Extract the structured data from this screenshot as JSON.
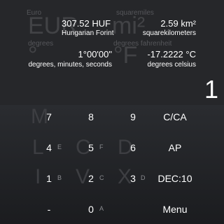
{
  "converter": {
    "row1": {
      "left_ghost_label": "Euro",
      "left_ghost_big": "EUR",
      "left_value": "307.52 HUF",
      "left_unit": "Hungarian Forint",
      "right_ghost_label": "squaremiles",
      "right_ghost_big": "mi²",
      "right_value": "2.59 km²",
      "right_unit": "squarekilometers"
    },
    "row2": {
      "left_ghost_label": "degrees",
      "left_ghost_big": "°",
      "left_value": "1°00'00\"",
      "left_unit": "degrees, minutes, seconds",
      "right_ghost_label": "degrees fahrenheit",
      "right_ghost_big": "°F",
      "right_value": "-17.2222 °C",
      "right_unit": "degrees celsius"
    }
  },
  "display": {
    "result": "1"
  },
  "keypad": {
    "ghost_letters": [
      "M",
      "L",
      "C",
      "D",
      "I",
      "V",
      "X"
    ],
    "rows": [
      {
        "keys": [
          {
            "label": "7",
            "hint": ""
          },
          {
            "label": "8",
            "hint": ""
          },
          {
            "label": "9",
            "hint": ""
          }
        ],
        "action": "C/CA"
      },
      {
        "keys": [
          {
            "label": "4",
            "hint": "E"
          },
          {
            "label": "5",
            "hint": "F"
          },
          {
            "label": "6",
            "hint": ""
          }
        ],
        "action": "AP"
      },
      {
        "keys": [
          {
            "label": "1",
            "hint": "B"
          },
          {
            "label": "2",
            "hint": "C"
          },
          {
            "label": "3",
            "hint": "D"
          }
        ],
        "action": "DEC:10"
      },
      {
        "keys": [
          {
            "label": "-",
            "hint": ""
          },
          {
            "label": "0",
            "hint": "A"
          },
          {
            "label": "",
            "hint": ""
          }
        ],
        "action": "Menu"
      }
    ]
  }
}
